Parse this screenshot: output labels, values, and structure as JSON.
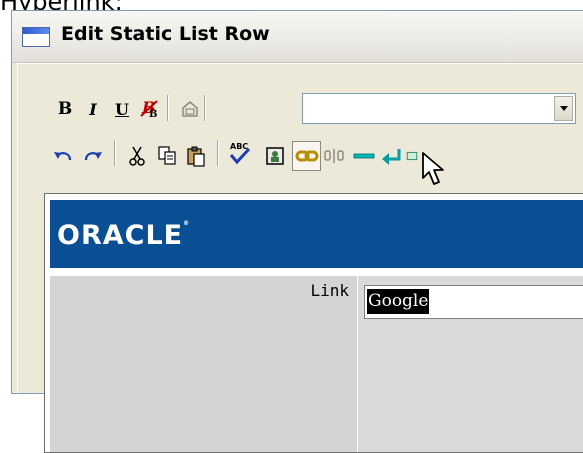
{
  "caption": {
    "text": "Hyperlink:"
  },
  "window": {
    "title": "Edit Static List Row"
  },
  "toolbar": {
    "bold_label": "B",
    "italic_label": "I",
    "underline_label": "U",
    "style_select_value": "",
    "spellcheck_label": "ABC"
  },
  "brand": {
    "logo_text": "ORACLE",
    "logo_mark": "®"
  },
  "form": {
    "link_label": "Link",
    "link_value": "Google"
  },
  "colors": {
    "brand_bar": "#0a4f94",
    "form_background": "#d6d6d6",
    "window_background": "#ece9d8",
    "selection": "#000000"
  },
  "icons": [
    "window-icon",
    "remove-format-icon",
    "paste-format-icon",
    "undo-icon",
    "redo-icon",
    "cut-icon",
    "copy-icon",
    "paste-icon",
    "spellcheck-icon",
    "image-icon",
    "hyperlink-icon",
    "anchor-icon",
    "horizontal-rule-icon",
    "line-break-icon",
    "mouse-pointer-icon"
  ]
}
